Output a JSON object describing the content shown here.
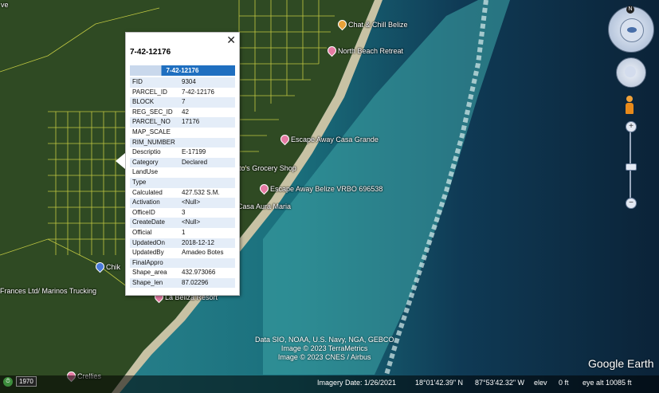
{
  "popup": {
    "title": "7-42-12176",
    "header": "7-42-12176",
    "close_label": "✕",
    "rows": [
      {
        "k": "FID",
        "v": "9304"
      },
      {
        "k": "PARCEL_ID",
        "v": "7-42-12176"
      },
      {
        "k": "BLOCK",
        "v": "7"
      },
      {
        "k": "REG_SEC_ID",
        "v": "42"
      },
      {
        "k": "PARCEL_NO",
        "v": "17176"
      },
      {
        "k": "MAP_SCALE",
        "v": ""
      },
      {
        "k": "RIM_NUMBER",
        "v": ""
      },
      {
        "k": "Descriptio",
        "v": "E-17199"
      },
      {
        "k": "Category",
        "v": "Declared"
      },
      {
        "k": "LandUse",
        "v": ""
      },
      {
        "k": "Type",
        "v": ""
      },
      {
        "k": "Calculated",
        "v": "427.532 S.M."
      },
      {
        "k": "Activation",
        "v": "<Null>"
      },
      {
        "k": "OfficeID",
        "v": "3"
      },
      {
        "k": "CreateDate",
        "v": "<Null>"
      },
      {
        "k": "Official",
        "v": "1"
      },
      {
        "k": "UpdatedOn",
        "v": "2018-12-12"
      },
      {
        "k": "UpdatedBy",
        "v": "Amadeo Botes"
      },
      {
        "k": "FinalAppro",
        "v": ""
      },
      {
        "k": "Shape_area",
        "v": "432.973066"
      },
      {
        "k": "Shape_len",
        "v": "87.02296"
      }
    ]
  },
  "places": {
    "chat_chill": "Chat & Chill Belize",
    "north_beach": "North Beach Retreat",
    "casa_grande": "Escape Away Casa Grande",
    "grocery": "to's Grocery Shop",
    "vrbo": "Escape Away Belize VRBO 696538",
    "casa_aura": "Casa Aura Maria",
    "chiki": "Chik",
    "marinos": "Frances Ltd/ Marinos Trucking",
    "la_beliza": "La Beliza Resort",
    "crellies": "Crellies",
    "top_left": "ve"
  },
  "credits": {
    "line1": "Data SIO, NOAA, U.S. Navy, NGA, GEBCO",
    "line2": "Image © 2023 TerraMetrics",
    "line3": "Image © 2023 CNES / Airbus"
  },
  "logo": "Google Earth",
  "status": {
    "imagery_date": "Imagery Date: 1/26/2021",
    "lat": "18°01'42.39\" N",
    "lon": "87°53'42.32\" W",
    "elev_label": "elev",
    "elev_value": "0 ft",
    "eye_alt": "eye alt  10085 ft"
  },
  "timeline": {
    "year": "1970"
  },
  "nav": {
    "north": "N",
    "zoom_in": "+",
    "zoom_out": "−"
  },
  "colors": {
    "header_blue": "#1f6fc0",
    "row_alt": "#e4edf8",
    "parcel_lines": "#e6e84a"
  }
}
